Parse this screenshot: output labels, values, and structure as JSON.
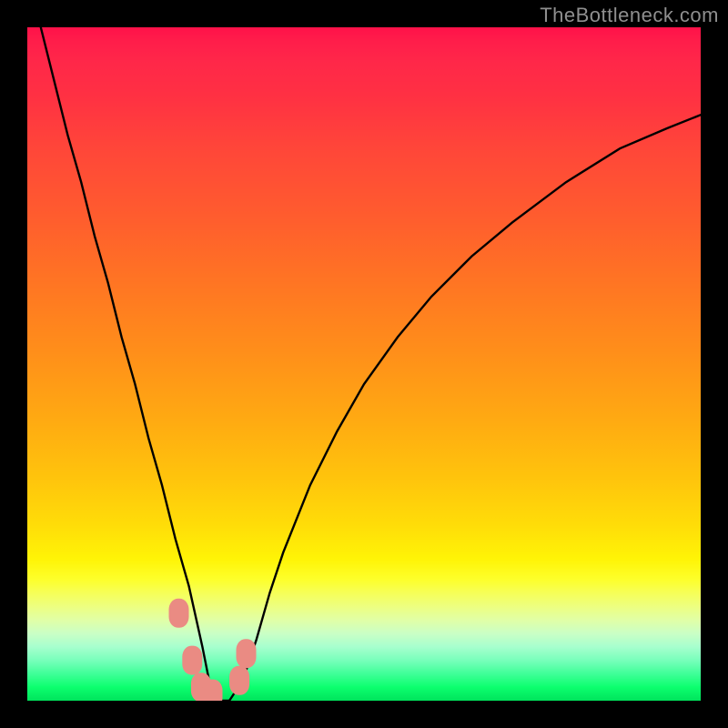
{
  "watermark": "TheBottleneck.com",
  "chart_data": {
    "type": "line",
    "title": "",
    "xlabel": "",
    "ylabel": "",
    "xlim": [
      0,
      100
    ],
    "ylim": [
      0,
      100
    ],
    "series": [
      {
        "name": "bottleneck-curve",
        "x": [
          0,
          2,
          4,
          6,
          8,
          10,
          12,
          14,
          16,
          18,
          20,
          22,
          24,
          26,
          27,
          28,
          30,
          32,
          34,
          36,
          38,
          42,
          46,
          50,
          55,
          60,
          66,
          72,
          80,
          88,
          95,
          100
        ],
        "y": [
          108,
          100,
          92,
          84,
          77,
          69,
          62,
          54,
          47,
          39,
          32,
          24,
          17,
          8,
          3,
          0,
          0,
          3,
          9,
          16,
          22,
          32,
          40,
          47,
          54,
          60,
          66,
          71,
          77,
          82,
          85,
          87
        ]
      }
    ],
    "markers": [
      {
        "name": "marker-a",
        "x": 22.5,
        "y": 13
      },
      {
        "name": "marker-b",
        "x": 24.5,
        "y": 6
      },
      {
        "name": "marker-c",
        "x": 25.8,
        "y": 2
      },
      {
        "name": "marker-d",
        "x": 27.5,
        "y": 1
      },
      {
        "name": "marker-e",
        "x": 31.5,
        "y": 3
      },
      {
        "name": "marker-f",
        "x": 32.5,
        "y": 7
      }
    ],
    "gradient_stops": [
      {
        "pct": 0,
        "color": "#ff1149"
      },
      {
        "pct": 50,
        "color": "#ff9017"
      },
      {
        "pct": 80,
        "color": "#fff406"
      },
      {
        "pct": 100,
        "color": "#00e35c"
      }
    ]
  }
}
